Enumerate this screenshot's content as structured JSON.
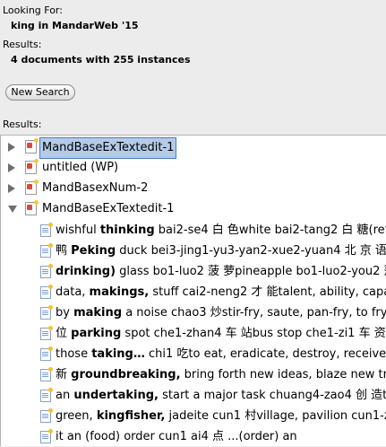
{
  "looking_for_label": "Looking For:",
  "query": "king in  MandarWeb '15",
  "results_label": "Results:",
  "results_summary": "4 documents with 255 instances",
  "new_search_label": "New Search",
  "results_list_label": "Results:",
  "documents": [
    {
      "name": "MandBaseExTextedit-1",
      "expanded": false,
      "selected": true
    },
    {
      "name": "untitled (WP)",
      "expanded": false,
      "selected": false
    },
    {
      "name": "MandBasexNum-2",
      "expanded": false,
      "selected": false
    },
    {
      "name": "MandBaseExTextedit-1",
      "expanded": true,
      "selected": false
    }
  ],
  "hits": [
    {
      "pre": "wishful ",
      "match": "thinking",
      "post": " bai2-se4 白 色white bai2-tang2 白 糖(refined"
    },
    {
      "pre": "鸭 ",
      "match": "Peking",
      "post": " duck bei3-jing1-yu3-yan2-xue2-yuan4 北 京 语"
    },
    {
      "pre": "",
      "match": "drinking)",
      "post": " glass bo1-luo2 菠 萝pineapple bo1-luo2-you2 菠"
    },
    {
      "pre": "data, ",
      "match": "makings,",
      "post": " stuff cai2-neng2 才 能talent, ability, capab"
    },
    {
      "pre": "by ",
      "match": "making",
      "post": " a noise chao3 炒stir-fry, saute, pan-fry, to fry"
    },
    {
      "pre": "位 ",
      "match": "parking",
      "post": " spot che1-zhan4 车 站bus stop che1-zi1 车 资"
    },
    {
      "pre": "those ",
      "match": "taking…",
      "post": " chi1 吃to eat, eradicate, destroy, receive c"
    },
    {
      "pre": "新 ",
      "match": "groundbreaking,",
      "post": " bring forth new ideas, blaze new trai"
    },
    {
      "pre": "an ",
      "match": "undertaking,",
      "post": " start a major task chuang4-zao4 创 造to"
    },
    {
      "pre": "green, ",
      "match": "kingfisher,",
      "post": " jadeite cun1 村village, pavilion cun1-z"
    },
    {
      "pre": "",
      "match": "",
      "post": "it an (food) order cun1 ai4 点 ...(order) an"
    }
  ]
}
